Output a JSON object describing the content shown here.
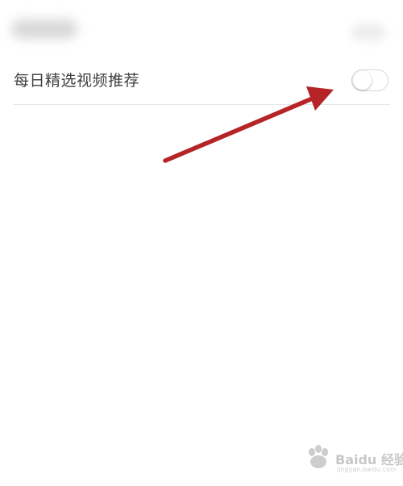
{
  "setting": {
    "label": "每日精选视频推荐",
    "toggle_on": false,
    "toggle_icon": "toggle-switch-icon"
  },
  "annotation": {
    "arrow_color": "#b52426",
    "arrow_icon": "arrow-icon"
  },
  "watermark": {
    "text": "Baidu 经验",
    "sub_text": "jingyan.baidu.com",
    "logo_icon": "paw-logo-icon"
  },
  "colors": {
    "background": "#ffffff",
    "label": "#3f3f3f",
    "divider": "#e6e6e6",
    "toggle_border": "#d6d6d6"
  }
}
